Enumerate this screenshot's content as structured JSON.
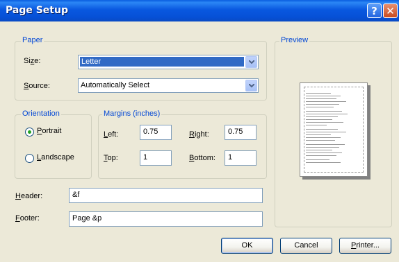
{
  "window": {
    "title": "Page Setup"
  },
  "titlebar": {
    "help_label": "?",
    "close_label": "✕"
  },
  "paper": {
    "legend": "Paper",
    "size_label": [
      "Si",
      "z",
      "e:"
    ],
    "size_value": "Letter",
    "source_label": [
      "",
      "S",
      "ource:"
    ],
    "source_value": "Automatically Select"
  },
  "orientation": {
    "legend": "Orientation",
    "portrait_label": [
      "",
      "P",
      "ortrait"
    ],
    "landscape_label": [
      "",
      "L",
      "andscape"
    ],
    "selected": "portrait"
  },
  "margins": {
    "legend": "Margins (inches)",
    "left_label": [
      "",
      "L",
      "eft:"
    ],
    "left_value": "0.75",
    "right_label": [
      "",
      "R",
      "ight:"
    ],
    "right_value": "0.75",
    "top_label": [
      "",
      "T",
      "op:"
    ],
    "top_value": "1",
    "bottom_label": [
      "",
      "B",
      "ottom:"
    ],
    "bottom_value": "1"
  },
  "header_footer": {
    "header_label": [
      "",
      "H",
      "eader:"
    ],
    "header_value": "&f",
    "footer_label": [
      "",
      "F",
      "ooter:"
    ],
    "footer_value": "Page &p"
  },
  "preview": {
    "legend": "Preview"
  },
  "buttons": {
    "ok_label": "OK",
    "cancel_label": "Cancel",
    "printer_label": [
      "",
      "P",
      "rinter..."
    ]
  },
  "colors": {
    "titlebar": "#0A5FE0",
    "accent": "#316AC5",
    "group_label": "#0046D5",
    "radio_dot": "#21A121"
  }
}
